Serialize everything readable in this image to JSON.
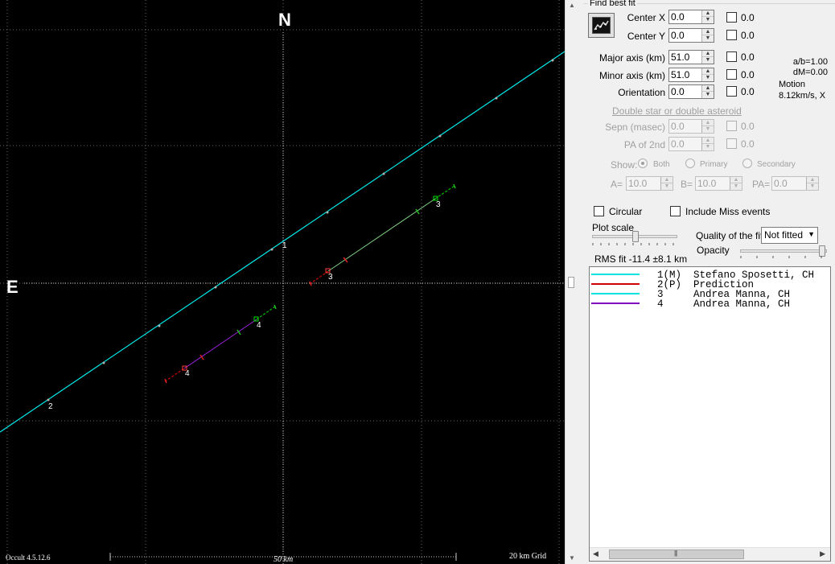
{
  "plot": {
    "north_label": "N",
    "east_label": "E",
    "version": "Occult 4.5.12.6",
    "scale_label": "50 km",
    "grid_label": "20 km Grid",
    "chord_labels": [
      "1",
      "2",
      "3",
      "3",
      "4",
      "4"
    ]
  },
  "panel": {
    "find_best_fit": "Find best fit",
    "center_x": {
      "label": "Center X",
      "value": "0.0",
      "check_label": "0.0"
    },
    "center_y": {
      "label": "Center Y",
      "value": "0.0",
      "check_label": "0.0"
    },
    "major_axis": {
      "label": "Major axis (km)",
      "value": "51.0",
      "check_label": "0.0"
    },
    "minor_axis": {
      "label": "Minor axis (km)",
      "value": "51.0",
      "check_label": "0.0"
    },
    "orientation": {
      "label": "Orientation",
      "value": "0.0",
      "check_label": "0.0"
    },
    "ratios": {
      "ab": "a/b=1.00",
      "dm": "dM=0.00",
      "motion_label": "Motion",
      "motion_value": "8.12km/s, X"
    },
    "double_star_link": "Double star  or  double asteroid",
    "sepn": {
      "label": "Sepn (masec)",
      "value": "0.0",
      "check_label": "0.0"
    },
    "pa2nd": {
      "label": "PA of 2nd",
      "value": "0.0",
      "check_label": "0.0"
    },
    "show": {
      "label": "Show:",
      "options": [
        "Both",
        "Primary",
        "Secondary"
      ]
    },
    "a": {
      "label": "A=",
      "value": "10.0"
    },
    "b": {
      "label": "B=",
      "value": "10.0"
    },
    "pa": {
      "label": "PA=",
      "value": "0.0"
    },
    "circular_label": "Circular",
    "include_miss_label": "Include Miss events",
    "plot_scale_label": "Plot scale",
    "quality_label": "Quality of the fit",
    "quality_value": "Not fitted",
    "opacity_label": "Opacity",
    "rms_fit": "RMS fit -11.4 ±8.1 km"
  },
  "legend": [
    {
      "color": "#00e0e0",
      "text": "1(M)  Stefano Sposetti, CH"
    },
    {
      "color": "#d00000",
      "text": "2(P)  Prediction"
    },
    {
      "color": "#00e0e0",
      "text": "3     Andrea Manna, CH"
    },
    {
      "color": "#8000c0",
      "text": "4     Andrea Manna, CH"
    }
  ],
  "colors": {
    "chord_cyan": "#00e8e8",
    "prediction_red": "#d00000",
    "chord_green": "#80d080",
    "chord_purple": "#a020e0",
    "event_green": "#00c000"
  }
}
